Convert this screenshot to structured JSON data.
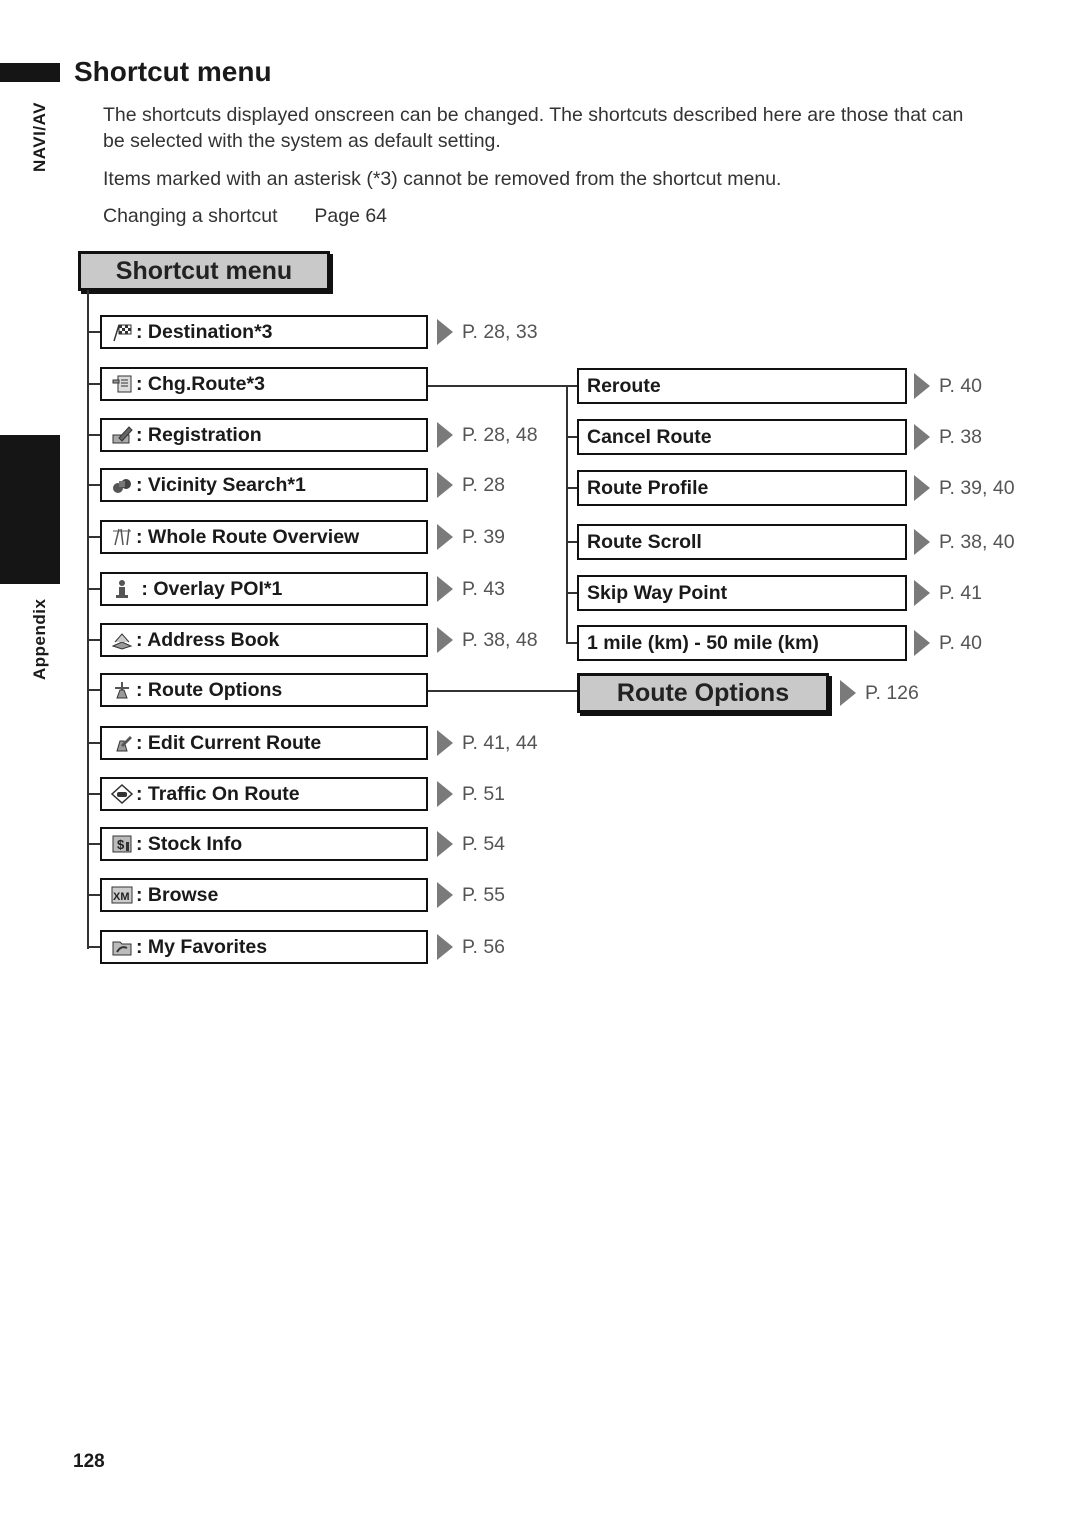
{
  "sidebar": {
    "section_tab": "NAVI/AV",
    "appendix_tab": "Appendix"
  },
  "page": {
    "title": "Shortcut menu",
    "intro_line1": "The shortcuts displayed onscreen can be changed. The shortcuts described here are those that can",
    "intro_line2": "be selected with the system as default setting.",
    "asterisk_note": "Items marked with an asterisk (*3) cannot be removed from the shortcut menu.",
    "cross_ref_label": "Changing a shortcut",
    "cross_ref_page": "Page 64",
    "page_number": "128"
  },
  "diagram": {
    "root_label": "Shortcut menu",
    "items": [
      {
        "icon": "checkered-flag-icon",
        "label": ": Destination*3",
        "ref": "P. 28, 33"
      },
      {
        "icon": "route-sign-icon",
        "label": ": Chg.Route*3",
        "ref": ""
      },
      {
        "icon": "registration-pen-icon",
        "label": ": Registration",
        "ref": "P. 28, 48"
      },
      {
        "icon": "binoculars-icon",
        "label": ": Vicinity Search*1",
        "ref": "P. 28"
      },
      {
        "icon": "route-overview-icon",
        "label": ": Whole Route Overview",
        "ref": "P. 39"
      },
      {
        "icon": "info-poi-icon",
        "label": " : Overlay POI*1",
        "ref": "P. 43"
      },
      {
        "icon": "address-book-icon",
        "label": ": Address Book",
        "ref": "P. 38, 48"
      },
      {
        "icon": "route-options-icon",
        "label": ": Route Options",
        "ref": ""
      },
      {
        "icon": "edit-route-icon",
        "label": ": Edit Current Route",
        "ref": "P. 41, 44"
      },
      {
        "icon": "traffic-car-icon",
        "label": ": Traffic On Route",
        "ref": "P. 51"
      },
      {
        "icon": "stock-dollar-icon",
        "label": ": Stock Info",
        "ref": "P. 54"
      },
      {
        "icon": "xm-browse-icon",
        "label": ": Browse",
        "ref": "P. 55"
      },
      {
        "icon": "favorites-folder-icon",
        "label": ": My Favorites",
        "ref": "P. 56"
      }
    ],
    "chg_route_submenu": [
      {
        "label": "Reroute",
        "ref": "P. 40"
      },
      {
        "label": "Cancel Route",
        "ref": "P. 38"
      },
      {
        "label": "Route Profile",
        "ref": "P. 39, 40"
      },
      {
        "label": "Route Scroll",
        "ref": "P. 38, 40"
      },
      {
        "label": "Skip Way Point",
        "ref": "P. 41"
      },
      {
        "label": "1 mile (km) - 50 mile (km)",
        "ref": "P. 40"
      }
    ],
    "route_options_target": {
      "label": "Route Options",
      "ref": "P. 126"
    }
  },
  "colors": {
    "header_box_fill": "#c9c9c9",
    "ref_arrow": "#7a7a7a",
    "tab_black": "#151515"
  }
}
